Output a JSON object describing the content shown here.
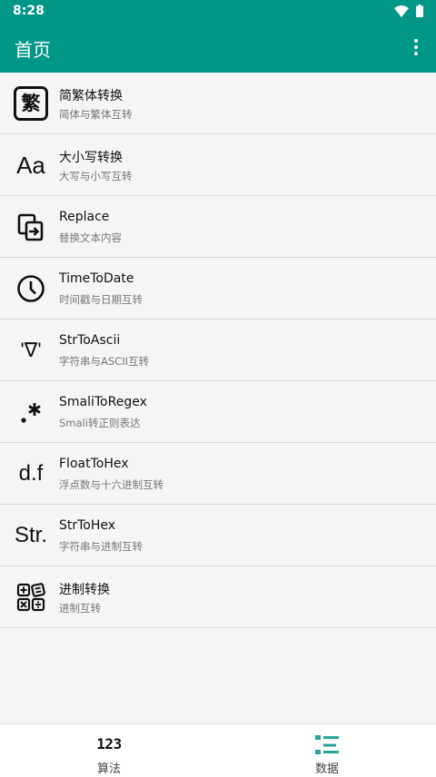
{
  "status": {
    "time": "8:28"
  },
  "appbar": {
    "title": "首页"
  },
  "items": [
    {
      "icon": "fan-char-icon",
      "icon_text": "繁",
      "title": "简繁体转换",
      "subtitle": "简体与繁体互转"
    },
    {
      "icon": "letter-case-icon",
      "icon_text": "Aa",
      "title": "大小写转换",
      "subtitle": "大写与小写互转"
    },
    {
      "icon": "replace-icon",
      "title": "Replace",
      "subtitle": "替换文本内容"
    },
    {
      "icon": "clock-icon",
      "title": "TimeToDate",
      "subtitle": "时间戳与日期互转"
    },
    {
      "icon": "ascii-face-icon",
      "icon_text": "'∇'",
      "title": "StrToAscii",
      "subtitle": "字符串与ASCII互转"
    },
    {
      "icon": "regex-icon",
      "title": "SmaliToRegex",
      "subtitle": "Smali转正则表达"
    },
    {
      "icon": "float-icon",
      "icon_text": "d.f",
      "title": "FloatToHex",
      "subtitle": "浮点数与十六进制互转"
    },
    {
      "icon": "string-icon",
      "icon_text": "Str.",
      "title": "StrToHex",
      "subtitle": "字符串与进制互转"
    },
    {
      "icon": "calculator-icon",
      "title": "进制转换",
      "subtitle": "进制互转"
    }
  ],
  "nav": [
    {
      "icon": "numbers-icon",
      "icon_text": "123",
      "label": "算法"
    },
    {
      "icon": "list-icon",
      "label": "数据"
    }
  ],
  "colors": {
    "primary": "#009688",
    "background": "#f5f5f5",
    "accent_icon": "#26a69a"
  }
}
